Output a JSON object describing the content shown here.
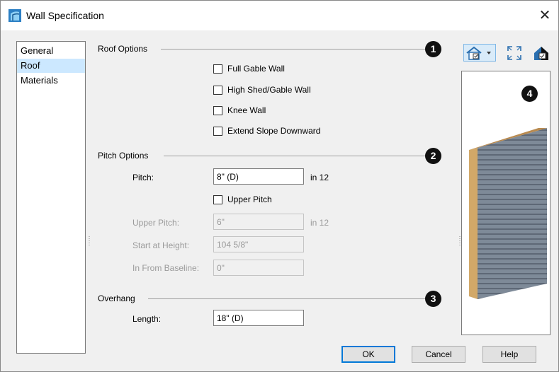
{
  "window": {
    "title": "Wall Specification",
    "close_glyph": "✕"
  },
  "sidebar": {
    "items": [
      {
        "label": "General",
        "selected": false
      },
      {
        "label": "Roof",
        "selected": true
      },
      {
        "label": "Materials",
        "selected": false
      }
    ]
  },
  "roof_options": {
    "label": "Roof Options",
    "badge": "1",
    "checkboxes": [
      {
        "label": "Full Gable Wall",
        "checked": false
      },
      {
        "label": "High Shed/Gable Wall",
        "checked": false
      },
      {
        "label": "Knee Wall",
        "checked": false
      },
      {
        "label": "Extend Slope Downward",
        "checked": false
      }
    ]
  },
  "pitch_options": {
    "label": "Pitch Options",
    "badge": "2",
    "pitch": {
      "label": "Pitch:",
      "value": "8\" (D)",
      "unit": "in 12"
    },
    "upper_pitch_check": {
      "label": "Upper Pitch",
      "checked": false
    },
    "upper_pitch": {
      "label": "Upper Pitch:",
      "value": "6\"",
      "unit": "in 12"
    },
    "start_at_height": {
      "label": "Start at Height:",
      "value": "104 5/8\""
    },
    "in_from_baseline": {
      "label": "In From Baseline:",
      "value": "0\""
    }
  },
  "overhang": {
    "label": "Overhang",
    "badge": "3",
    "length": {
      "label": "Length:",
      "value": "18\" (D)"
    }
  },
  "preview": {
    "badge": "4",
    "toolbar": [
      "view-options-dropdown-icon",
      "fill-window-icon",
      "preview-color-icon"
    ]
  },
  "buttons": {
    "ok": "OK",
    "cancel": "Cancel",
    "help": "Help"
  },
  "colors": {
    "accent": "#0078d7",
    "selection": "#cce8ff",
    "wood": "#d2a868",
    "siding": "#7e8a98"
  }
}
